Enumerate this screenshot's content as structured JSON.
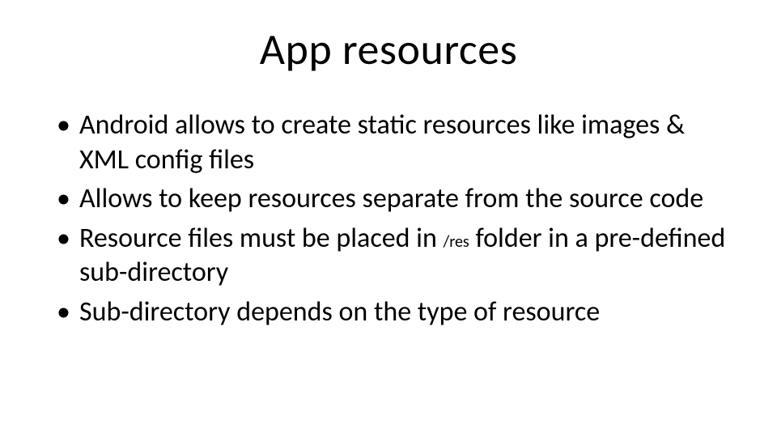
{
  "slide": {
    "title": "App resources",
    "bullets": [
      {
        "text": "Android allows to create static resources like images & XML config files"
      },
      {
        "text_a": "Allows to keep resources separate from the source code"
      },
      {
        "text_b1": "Resource files must be placed in ",
        "code": "/res",
        "text_b2": " folder in a pre-defined sub-directory"
      },
      {
        "text_c": "Sub-directory depends on the type of resource"
      }
    ]
  }
}
